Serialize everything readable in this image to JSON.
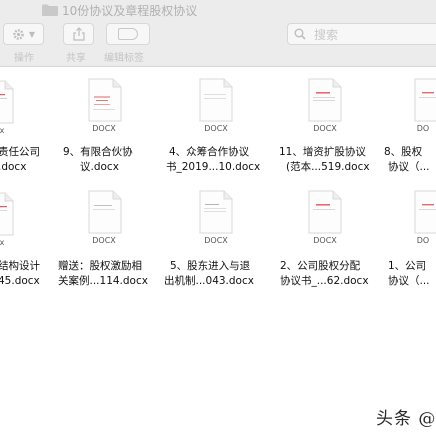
{
  "window": {
    "title": "10份协议及章程股权协议"
  },
  "toolbar": {
    "action_label": "操作",
    "share_label": "共享",
    "edit_tags_label": "编辑标签",
    "search_placeholder": "搜索"
  },
  "files_row1": [
    {
      "ext": "x",
      "name_line1": "责任公司",
      "name_line2": ".docx"
    },
    {
      "ext": "DOCX",
      "name_line1": "9、有限合伙协",
      "name_line2": "议.docx"
    },
    {
      "ext": "DOCX",
      "name_line1": "4、众筹合作协议",
      "name_line2": "书_2019...10.docx"
    },
    {
      "ext": "DOCX",
      "name_line1": "11、增资扩股协议",
      "name_line2": "(范本...519.docx"
    },
    {
      "ext": "DO",
      "name_line1": "8、股权",
      "name_line2": "协议（..."
    }
  ],
  "files_row2": [
    {
      "ext": "x",
      "name_line1": "结构设计",
      "name_line2": "45.docx"
    },
    {
      "ext": "DOCX",
      "name_line1": "赠送：股权激励相",
      "name_line2": "关案例...114.docx"
    },
    {
      "ext": "DOCX",
      "name_line1": "5、股东进入与退",
      "name_line2": "出机制...043.docx"
    },
    {
      "ext": "DOCX",
      "name_line1": "2、公司股权分配",
      "name_line2": "协议书_...62.docx"
    },
    {
      "ext": "DO",
      "name_line1": "1、公司",
      "name_line2": "协议（..."
    }
  ],
  "watermark": {
    "text": "头条 @"
  }
}
